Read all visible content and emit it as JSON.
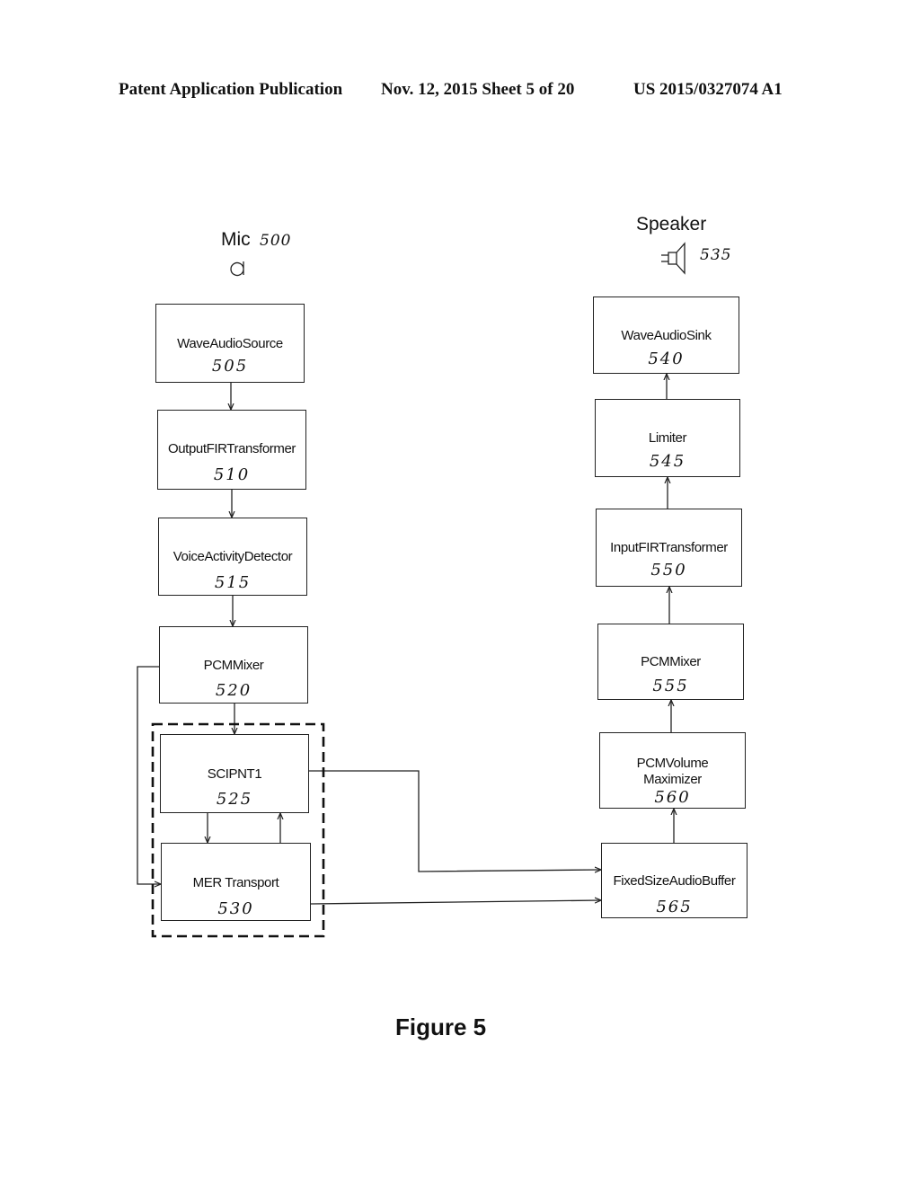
{
  "header": {
    "publication": "Patent Application Publication",
    "date_sheet": "Nov. 12, 2015   Sheet 5 of 20",
    "number": "US 2015/0327074 A1"
  },
  "mic": {
    "label": "Mic",
    "ref": "500",
    "icon": "microphone-icon"
  },
  "speaker": {
    "label": "Speaker",
    "ref": "535",
    "icon": "speaker-icon"
  },
  "left_chain": [
    {
      "name": "WaveAudioSource",
      "ref": "505"
    },
    {
      "name": "OutputFIRTransformer",
      "ref": "510"
    },
    {
      "name": "VoiceActivityDetector",
      "ref": "515"
    },
    {
      "name": "PCMMixer",
      "ref": "520"
    },
    {
      "name": "SCIPNT1",
      "ref": "525"
    },
    {
      "name": "MER Transport",
      "ref": "530"
    }
  ],
  "right_chain": [
    {
      "name": "WaveAudioSink",
      "ref": "540"
    },
    {
      "name": "Limiter",
      "ref": "545"
    },
    {
      "name": "InputFIRTransformer",
      "ref": "550"
    },
    {
      "name": "PCMMixer",
      "ref": "555"
    },
    {
      "name": "PCMVolume",
      "name2": "Maximizer",
      "ref": "560"
    },
    {
      "name": "FixedSizeAudioBuffer",
      "ref": "565"
    }
  ],
  "caption": "Figure 5"
}
